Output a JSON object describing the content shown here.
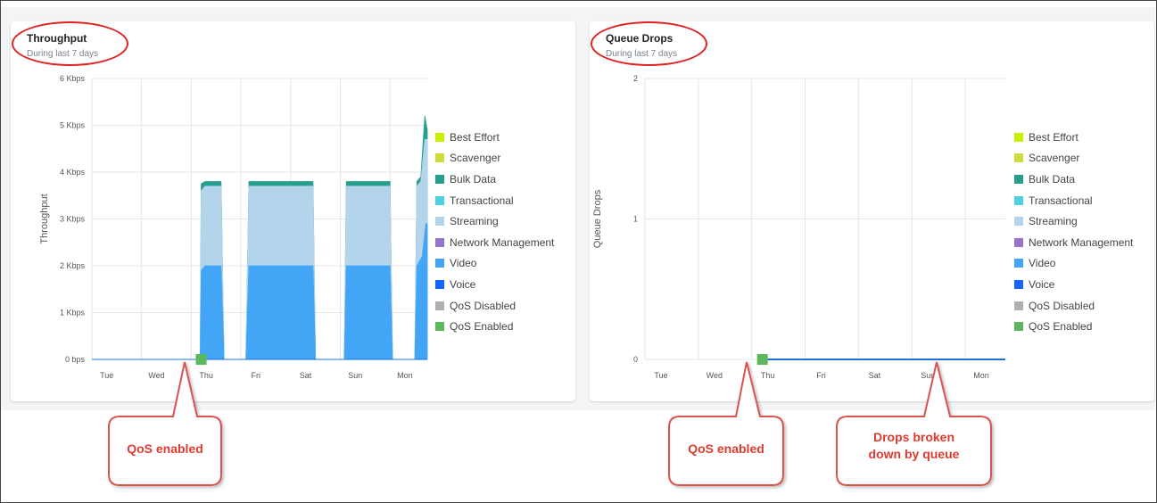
{
  "panels": [
    {
      "title": "Throughput",
      "subtitle": "During last 7 days",
      "legend": [
        {
          "label": "Best Effort",
          "color": "#c6f200"
        },
        {
          "label": "Scavenger",
          "color": "#cddc39"
        },
        {
          "label": "Bulk Data",
          "color": "#26a08d"
        },
        {
          "label": "Transactional",
          "color": "#4dd0e1"
        },
        {
          "label": "Streaming",
          "color": "#b3d4ea"
        },
        {
          "label": "Network Management",
          "color": "#9575cd"
        },
        {
          "label": "Video",
          "color": "#42a5f5"
        },
        {
          "label": "Voice",
          "color": "#1565ff"
        },
        {
          "label": "QoS Disabled",
          "color": "#b0b0b0"
        },
        {
          "label": "QoS Enabled",
          "color": "#5cb85c"
        }
      ]
    },
    {
      "title": "Queue Drops",
      "subtitle": "During last 7 days",
      "legend": [
        {
          "label": "Best Effort",
          "color": "#c6f200"
        },
        {
          "label": "Scavenger",
          "color": "#cddc39"
        },
        {
          "label": "Bulk Data",
          "color": "#26a08d"
        },
        {
          "label": "Transactional",
          "color": "#4dd0e1"
        },
        {
          "label": "Streaming",
          "color": "#b3d4ea"
        },
        {
          "label": "Network Management",
          "color": "#9575cd"
        },
        {
          "label": "Video",
          "color": "#42a5f5"
        },
        {
          "label": "Voice",
          "color": "#1565ff"
        },
        {
          "label": "QoS Disabled",
          "color": "#b0b0b0"
        },
        {
          "label": "QoS Enabled",
          "color": "#5cb85c"
        }
      ]
    }
  ],
  "callouts": {
    "qos_enabled_left": "QoS enabled",
    "qos_enabled_right": "QoS enabled",
    "drops_line1": "Drops broken",
    "drops_line2": "down by queue"
  },
  "colors": {
    "callout_red": "#e03a2f",
    "circle_red": "#e02222",
    "line_blue": "#1e6fd9"
  },
  "chart_data": [
    {
      "type": "area",
      "title": "Throughput",
      "subtitle": "During last 7 days",
      "ylabel": "Throughput",
      "y_ticks": [
        "0 bps",
        "1 Kbps",
        "2 Kbps",
        "3 Kbps",
        "4 Kbps",
        "5 Kbps",
        "6 Kbps"
      ],
      "ylim": [
        0,
        6
      ],
      "y_unit": "Kbps",
      "x_ticks": [
        "Tue",
        "Wed",
        "Thu",
        "Fri",
        "Sat",
        "Sun",
        "Mon"
      ],
      "xlim": [
        0,
        6.75
      ],
      "stacked": true,
      "legend_position": "right",
      "grid": true,
      "qos_enabled_marker_x": 2.2,
      "series": [
        {
          "name": "Video",
          "color": "#42a5f5",
          "points": [
            [
              2.18,
              0
            ],
            [
              2.2,
              1.9
            ],
            [
              2.28,
              2.0
            ],
            [
              2.6,
              2.0
            ],
            [
              2.66,
              0
            ],
            [
              3.1,
              0
            ],
            [
              3.16,
              2.0
            ],
            [
              4.45,
              2.0
            ],
            [
              4.5,
              0
            ],
            [
              5.08,
              0
            ],
            [
              5.12,
              2.0
            ],
            [
              6.0,
              2.0
            ],
            [
              6.05,
              0
            ],
            [
              6.5,
              0
            ],
            [
              6.54,
              2.0
            ],
            [
              6.65,
              2.2
            ],
            [
              6.72,
              2.9
            ],
            [
              6.75,
              2.9
            ]
          ]
        },
        {
          "name": "Streaming",
          "color": "#b3d4ea",
          "points": [
            [
              2.18,
              0
            ],
            [
              2.2,
              3.6
            ],
            [
              2.28,
              3.7
            ],
            [
              2.6,
              3.7
            ],
            [
              2.66,
              0
            ],
            [
              3.1,
              0
            ],
            [
              3.16,
              3.7
            ],
            [
              4.45,
              3.7
            ],
            [
              4.5,
              0
            ],
            [
              5.08,
              0
            ],
            [
              5.12,
              3.7
            ],
            [
              6.0,
              3.7
            ],
            [
              6.05,
              0
            ],
            [
              6.5,
              0
            ],
            [
              6.54,
              3.7
            ],
            [
              6.62,
              3.8
            ],
            [
              6.7,
              4.7
            ],
            [
              6.75,
              4.7
            ]
          ]
        },
        {
          "name": "Bulk Data",
          "color": "#26a08d",
          "points": [
            [
              2.18,
              0
            ],
            [
              2.2,
              3.75
            ],
            [
              2.28,
              3.8
            ],
            [
              2.6,
              3.8
            ],
            [
              2.66,
              0
            ],
            [
              3.1,
              0
            ],
            [
              3.16,
              3.8
            ],
            [
              4.45,
              3.8
            ],
            [
              4.5,
              0
            ],
            [
              5.08,
              0
            ],
            [
              5.12,
              3.8
            ],
            [
              6.0,
              3.8
            ],
            [
              6.05,
              0
            ],
            [
              6.5,
              0
            ],
            [
              6.54,
              3.8
            ],
            [
              6.62,
              3.9
            ],
            [
              6.7,
              5.2
            ],
            [
              6.75,
              4.9
            ]
          ]
        }
      ]
    },
    {
      "type": "line",
      "title": "Queue Drops",
      "subtitle": "During last 7 days",
      "ylabel": "Queue Drops",
      "y_ticks": [
        "0",
        "1",
        "2"
      ],
      "ylim": [
        0,
        2
      ],
      "x_ticks": [
        "Tue",
        "Wed",
        "Thu",
        "Fri",
        "Sat",
        "Sun",
        "Mon"
      ],
      "xlim": [
        0,
        6.75
      ],
      "legend_position": "right",
      "grid": true,
      "qos_enabled_marker_x": 2.2,
      "series": [
        {
          "name": "Queue Drops",
          "color": "#1e6fd9",
          "points": [
            [
              2.2,
              0
            ],
            [
              6.75,
              0
            ]
          ]
        }
      ]
    }
  ]
}
